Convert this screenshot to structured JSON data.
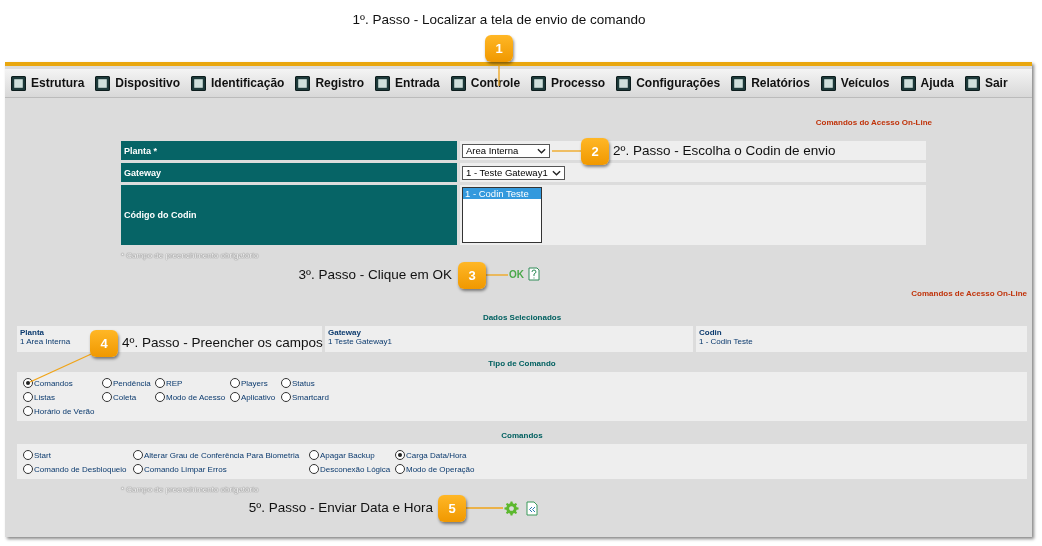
{
  "menu": [
    {
      "label": "Estrutura"
    },
    {
      "label": "Dispositivo"
    },
    {
      "label": "Identificação"
    },
    {
      "label": "Registro"
    },
    {
      "label": "Entrada"
    },
    {
      "label": "Controle"
    },
    {
      "label": "Processo"
    },
    {
      "label": "Configurações"
    },
    {
      "label": "Relatórios"
    },
    {
      "label": "Veículos"
    },
    {
      "label": "Ajuda"
    },
    {
      "label": "Sair"
    }
  ],
  "form": {
    "heading": "Comandos do Acesso On-Line",
    "fields": [
      {
        "kind": "select",
        "label": "Planta *",
        "value": "Area Interna"
      },
      {
        "kind": "select",
        "label": "Gateway",
        "value": "1 - Teste Gateway1"
      },
      {
        "kind": "listbox",
        "label": "Código do Codin",
        "options": [
          {
            "label": "1 - Codin Teste",
            "selected": true
          }
        ]
      }
    ],
    "note": "* Campo de preenchimento obrigatório",
    "ok_button": "OK"
  },
  "results": {
    "heading": "Comandos de Acesso On-Line",
    "summary_title": "Dados Selecionados",
    "summary": [
      {
        "label": "Planta",
        "value": "1 Area Interna"
      },
      {
        "label": "Gateway",
        "value": "1 Teste Gateway1"
      },
      {
        "label": "Codin",
        "value": "1 - Codin Teste"
      }
    ],
    "command_type": {
      "title": "Tipo de Comando",
      "rows": [
        [
          {
            "label": "Comandos",
            "selected": true
          },
          {
            "label": "Pendência",
            "selected": false
          },
          {
            "label": "REP",
            "selected": false
          },
          {
            "label": "Players",
            "selected": false
          },
          {
            "label": "Status",
            "selected": false
          }
        ],
        [
          {
            "label": "Listas",
            "selected": false
          },
          {
            "label": "Coleta",
            "selected": false
          },
          {
            "label": "Modo de Acesso",
            "selected": false
          },
          {
            "label": "Aplicativo",
            "selected": false
          },
          {
            "label": "Smartcard",
            "selected": false
          }
        ],
        [
          {
            "label": "Horário de Verão",
            "selected": false
          }
        ]
      ]
    },
    "commands": {
      "title": "Comandos",
      "rows": [
        [
          {
            "label": "Start",
            "selected": false
          },
          {
            "label": "Alterar Grau de Conferência Para Biometria",
            "selected": false
          },
          {
            "label": "Apagar Backup",
            "selected": false
          },
          {
            "label": "Carga Data/Hora",
            "selected": true
          }
        ],
        [
          {
            "label": "Comando de Desbloqueio",
            "selected": false
          },
          {
            "label": "Comando Limpar Erros",
            "selected": false
          },
          {
            "label": "Desconexão Lógica",
            "selected": false
          },
          {
            "label": "Modo de Operação",
            "selected": false
          }
        ]
      ]
    },
    "note": "* Campo de preenchimento obrigatório"
  },
  "callouts": [
    {
      "number": "1",
      "text": "1º. Passo - Localizar a tela de envio de comando"
    },
    {
      "number": "2",
      "text": "2º. Passo - Escolha o Codin de envio"
    },
    {
      "number": "3",
      "text": "3º. Passo - Clique em OK"
    },
    {
      "number": "4",
      "text": "4º. Passo - Preencher os campos"
    },
    {
      "number": "5",
      "text": "5º. Passo - Enviar Data e Hora"
    }
  ]
}
